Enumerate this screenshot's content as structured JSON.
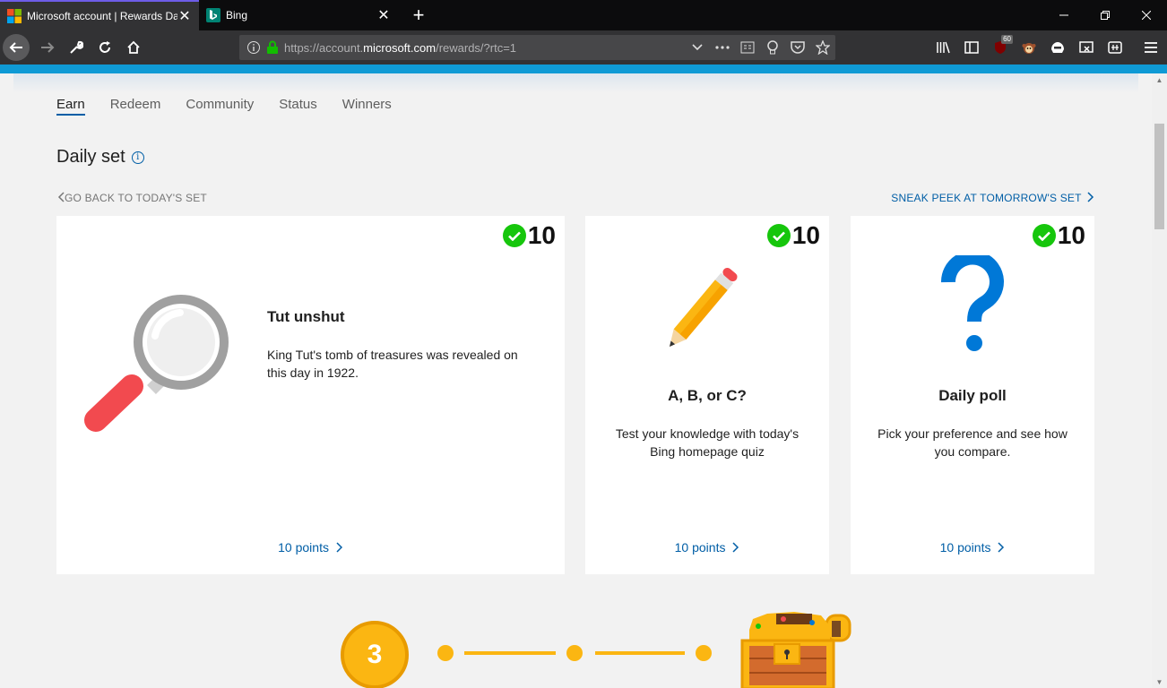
{
  "browser": {
    "tabs": [
      {
        "title": "Microsoft account | Rewards Da",
        "active": true,
        "icon": "microsoft-logo"
      },
      {
        "title": "Bing",
        "active": false,
        "icon": "bing-logo"
      }
    ],
    "url_prefix": "https://account.",
    "url_domain": "microsoft.com",
    "url_suffix": "/rewards/?rtc=1",
    "ublock_count": "60"
  },
  "nav": {
    "tabs": [
      "Earn",
      "Redeem",
      "Community",
      "Status",
      "Winners"
    ],
    "active_tab": "Earn"
  },
  "daily_set": {
    "title": "Daily set",
    "go_back": "GO BACK TO TODAY'S SET",
    "sneak_peek": "SNEAK PEEK AT TOMORROW'S SET",
    "cards": [
      {
        "points": "10",
        "title": "Tut unshut",
        "description": "King Tut's tomb of treasures was revealed on this day in 1922.",
        "link": "10 points",
        "icon": "magnifier-icon"
      },
      {
        "points": "10",
        "title": "A, B, or C?",
        "description": "Test your knowledge with today's Bing homepage quiz",
        "link": "10 points",
        "icon": "pencil-icon"
      },
      {
        "points": "10",
        "title": "Daily poll",
        "description": "Pick your preference and see how you compare.",
        "link": "10 points",
        "icon": "question-icon"
      }
    ]
  },
  "streak": {
    "count": "3"
  },
  "colors": {
    "accent": "#005ea6",
    "check": "#16c60c",
    "streak": "#fbb612"
  }
}
